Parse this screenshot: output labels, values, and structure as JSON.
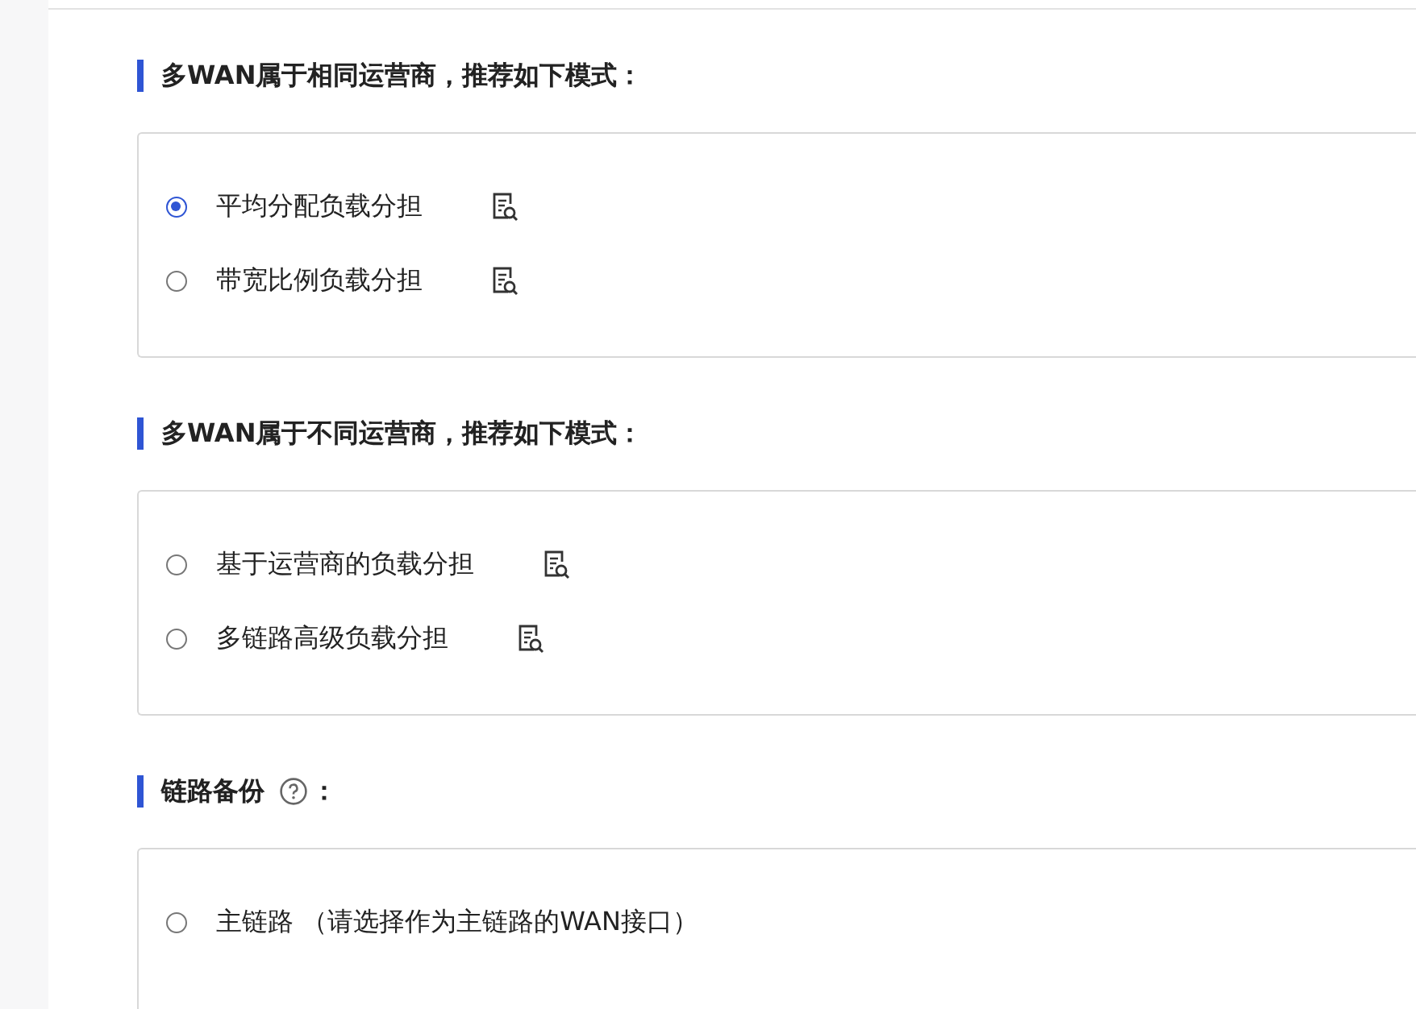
{
  "sections": [
    {
      "kind": "plain",
      "title": "多WAN属于相同运营商，推荐如下模式：",
      "options": [
        {
          "kind": "detail",
          "label": "平均分配负载分担",
          "selected": true
        },
        {
          "kind": "detail",
          "label": "带宽比例负载分担",
          "selected": false
        }
      ]
    },
    {
      "kind": "plain",
      "title": "多WAN属于不同运营商，推荐如下模式：",
      "options": [
        {
          "kind": "detail",
          "label": "基于运营商的负载分担",
          "selected": false
        },
        {
          "kind": "detail",
          "label": "多链路高级负载分担",
          "selected": false
        }
      ]
    },
    {
      "kind": "help",
      "title": "链路备份",
      "suffix": "：",
      "options": [
        {
          "kind": "plain",
          "label": "主链路 （请选择作为主链路的WAN接口）",
          "selected": false
        }
      ]
    }
  ]
}
